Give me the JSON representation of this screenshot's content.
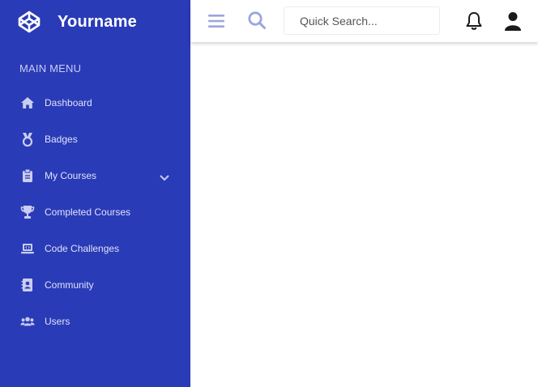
{
  "brand": {
    "name": "Yourname",
    "logo_icon": "codepen-icon"
  },
  "sidebar": {
    "heading": "MAIN MENU",
    "background": "#2a3bb7",
    "items": [
      {
        "label": "Dashboard",
        "icon": "home-icon"
      },
      {
        "label": "Badges",
        "icon": "medal-icon"
      },
      {
        "label": "My Courses",
        "icon": "clipboard-icon",
        "has_submenu": true
      },
      {
        "label": "Completed Courses",
        "icon": "trophy-icon"
      },
      {
        "label": "Code Challenges",
        "icon": "laptop-code-icon"
      },
      {
        "label": "Community",
        "icon": "address-book-icon"
      },
      {
        "label": "Users",
        "icon": "users-icon"
      }
    ]
  },
  "topbar": {
    "search_placeholder": "Quick Search...",
    "icon_color": "#9aa5dd",
    "icons": [
      "hamburger-menu-icon",
      "search-icon",
      "bell-icon",
      "user-icon"
    ]
  }
}
